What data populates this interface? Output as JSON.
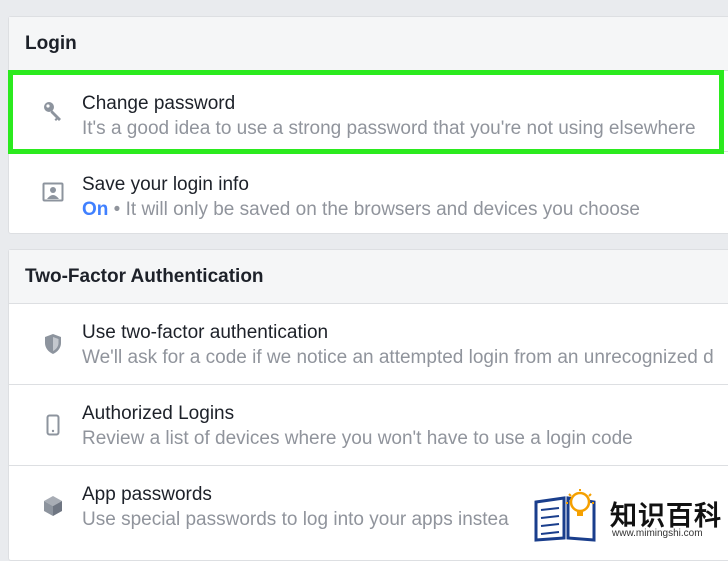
{
  "login_section": {
    "title": "Login",
    "items": [
      {
        "icon": "key-icon",
        "title": "Change password",
        "description": "It's a good idea to use a strong password that you're not using elsewhere"
      },
      {
        "icon": "contact-card-icon",
        "title": "Save your login info",
        "status": "On",
        "separator": "•",
        "description": "It will only be saved on the browsers and devices you choose"
      }
    ]
  },
  "two_factor_section": {
    "title": "Two-Factor Authentication",
    "items": [
      {
        "icon": "shield-icon",
        "title": "Use two-factor authentication",
        "description": "We'll ask for a code if we notice an attempted login from an unrecognized d"
      },
      {
        "icon": "phone-icon",
        "title": "Authorized Logins",
        "description": "Review a list of devices where you won't have to use a login code"
      },
      {
        "icon": "cube-icon",
        "title": "App passwords",
        "description": "Use special passwords to log into your apps instea"
      }
    ]
  },
  "watermark": {
    "text": "知识百科",
    "url": "www.mimingshi.com"
  },
  "colors": {
    "highlight": "#2bea1e",
    "status_on": "#4080ff",
    "title_text": "#1d2129",
    "description_text": "#90949c",
    "page_background": "#e9ebee"
  }
}
